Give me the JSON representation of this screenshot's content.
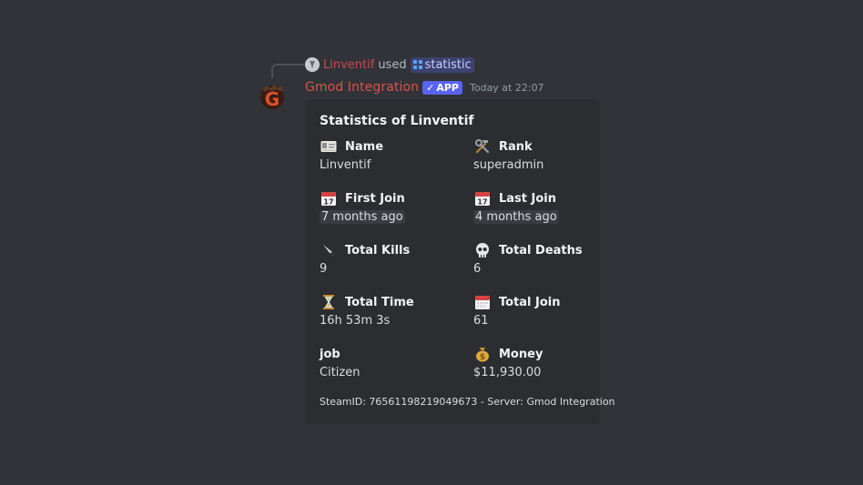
{
  "reply": {
    "user": "Linventif",
    "used_text": "used",
    "command": "statistic"
  },
  "message": {
    "bot_name": "Gmod Integration",
    "badge": "APP",
    "timestamp": "Today at 22:07"
  },
  "embed": {
    "title": "Statistics of Linventif",
    "fields": [
      {
        "icon": "id-card-icon",
        "name": "Name",
        "value": "Linventif",
        "timestamp": false
      },
      {
        "icon": "hammer-wrench-icon",
        "name": "Rank",
        "value": "superadmin",
        "timestamp": false
      },
      {
        "icon": "calendar-icon",
        "name": "First Join",
        "value": "7 months ago",
        "timestamp": true
      },
      {
        "icon": "calendar-icon",
        "name": "Last Join",
        "value": "4 months ago",
        "timestamp": true
      },
      {
        "icon": "knife-icon",
        "name": "Total Kills",
        "value": "9",
        "timestamp": false
      },
      {
        "icon": "skull-icon",
        "name": "Total Deaths",
        "value": "6",
        "timestamp": false
      },
      {
        "icon": "hourglass-icon",
        "name": "Total Time",
        "value": "16h 53m 3s",
        "timestamp": false
      },
      {
        "icon": "spiral-calendar-icon",
        "name": "Total Join",
        "value": "61",
        "timestamp": false
      },
      {
        "icon": "",
        "name": "job",
        "value": "Citizen",
        "timestamp": false
      },
      {
        "icon": "money-bag-icon",
        "name": "Money",
        "value": "$11,930.00",
        "timestamp": false
      }
    ],
    "footer": "SteamID: 76561198219049673 - Server: Gmod Integration"
  },
  "colors": {
    "background": "#313338",
    "embed_background": "#2b2d31",
    "bot_name": "#d9534f",
    "app_badge": "#5865f2",
    "command_pill": "#3c4270"
  }
}
